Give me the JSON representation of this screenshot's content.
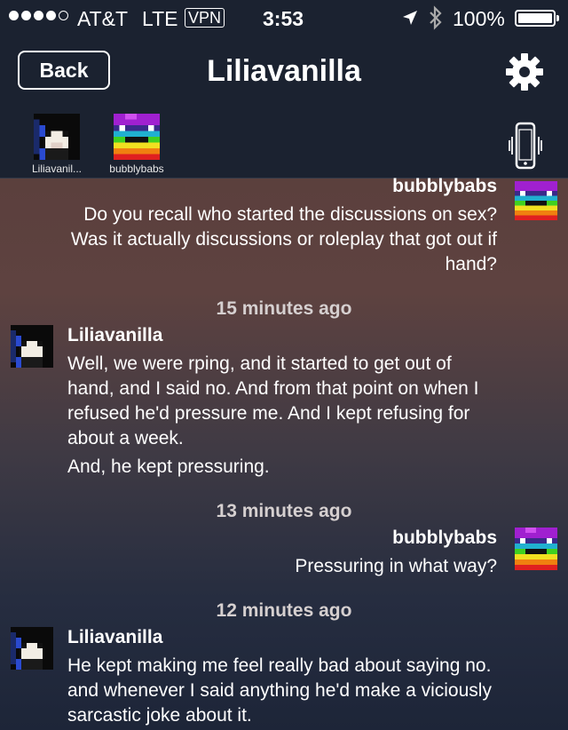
{
  "status_bar": {
    "carrier": "AT&T",
    "network": "LTE",
    "vpn": "VPN",
    "time": "3:53",
    "battery": "100%",
    "signal_bars_filled": 4,
    "signal_bars_total": 5
  },
  "nav": {
    "back_label": "Back",
    "title": "Liliavanilla"
  },
  "participants": [
    {
      "name": "Liliavanil..."
    },
    {
      "name": "bubblybabs"
    }
  ],
  "messages": [
    {
      "sender": "bubblybabs",
      "lines": [
        "Do you recall who started the discussions on sex?",
        "Was it actually discussions or roleplay that got out if",
        "hand?"
      ]
    },
    {
      "timestamp": "15 minutes ago"
    },
    {
      "sender": "Liliavanilla",
      "lines": [
        "Well, we were rping, and it started to get out of",
        "hand, and I said no. And from that point on when I",
        "refused he'd pressure me. And I kept refusing for",
        "about a week."
      ],
      "extra": "And, he kept pressuring."
    },
    {
      "timestamp": "13 minutes ago"
    },
    {
      "sender": "bubblybabs",
      "lines": [
        "Pressuring in what way?"
      ]
    },
    {
      "timestamp": "12 minutes ago"
    },
    {
      "sender": "Liliavanilla",
      "lines": [
        "He kept making me feel really bad about saying no.",
        "and whenever I said anything he'd make a viciously",
        "sarcastic joke about it."
      ]
    }
  ],
  "colors": {
    "bar_background": "#1b2230",
    "timestamp_text": "#d6d0d0"
  },
  "icons": [
    "location-arrow-icon",
    "bluetooth-icon",
    "battery-icon",
    "gear-icon",
    "phone-vibrate-icon"
  ]
}
